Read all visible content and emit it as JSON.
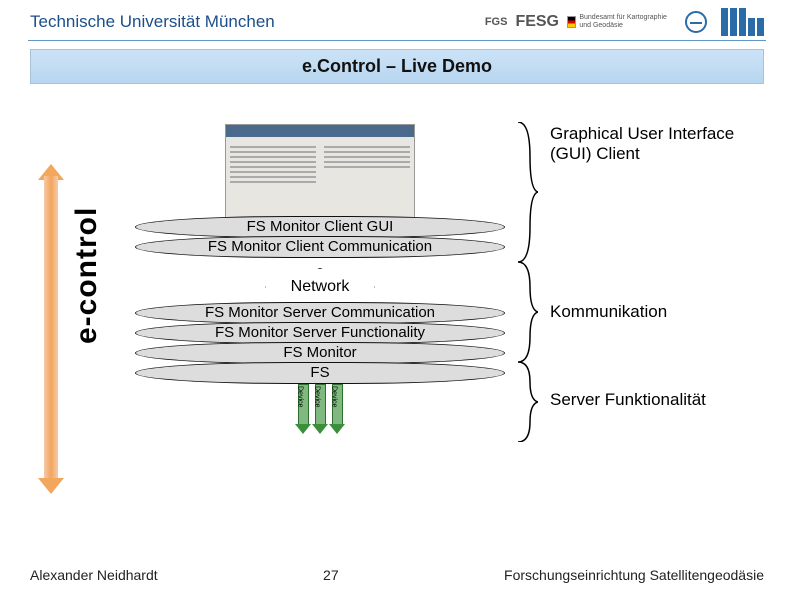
{
  "header": {
    "university": "Technische Universität München"
  },
  "logos": {
    "fgs": "FGS",
    "fesg": "FESG",
    "bkg": "Bundesamt für Kartographie und Geodäsie"
  },
  "title": "e.Control – Live Demo",
  "sidebar_label": "e-control",
  "stack": {
    "fs_client_gui": "FS Monitor Client GUI",
    "fs_client_comm": "FS Monitor Client Communication",
    "network": "Network",
    "fs_server_comm": "FS Monitor Server Communication",
    "fs_server_func": "FS Monitor Server Functionality",
    "fs_monitor": "FS Monitor",
    "fs": "FS",
    "device": "Device"
  },
  "right": {
    "gui_client": "Graphical User Interface (GUI) Client",
    "kommunikation": "Kommunikation",
    "server_funktionalitaet": "Server Funktionalität"
  },
  "footer": {
    "author": "Alexander Neidhardt",
    "page": "27",
    "org": "Forschungseinrichtung Satellitengeodäsie"
  }
}
